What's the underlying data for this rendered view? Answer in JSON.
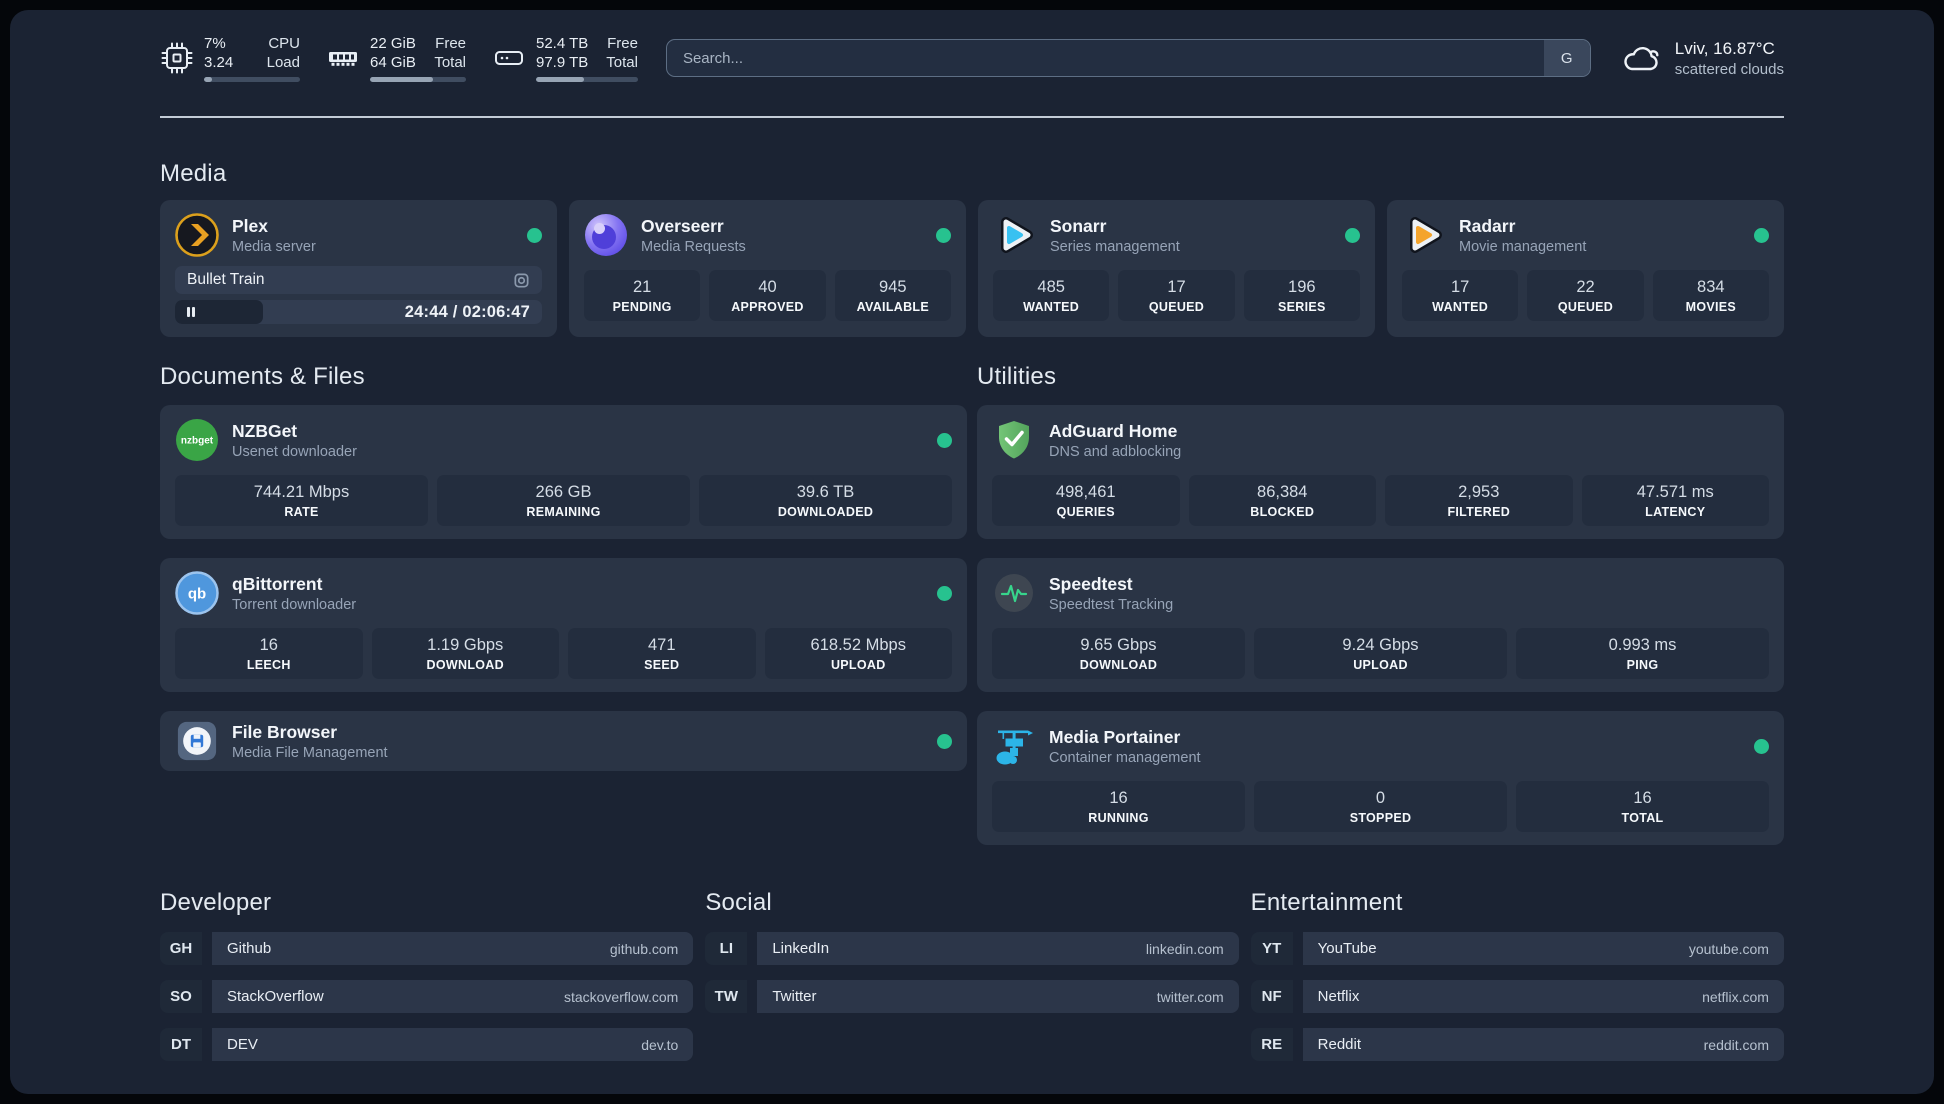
{
  "colors": {
    "background": "#1b2333",
    "card": "#2a3445",
    "stat_box": "#232d3e",
    "player_pill": "#323d51",
    "player_pause_bg": "#1d2635",
    "accent_green": "#27c28f",
    "divider": "#ccd5df",
    "bookmark_abbr_bg": "#1f2938",
    "bookmark_pill_bg": "#2c3649",
    "search_border": "#5d6e84",
    "search_bg": "#232e41",
    "search_engine_bg": "#3a475c",
    "progress_track": "#404d61",
    "progress_fill": "#97a4b4",
    "text_secondary": "#97a4b7"
  },
  "system": {
    "stats": [
      {
        "icon": "cpu",
        "v1": "7%",
        "v2": "3.24",
        "l1": "CPU",
        "l2": "Load",
        "progress": 8
      },
      {
        "icon": "memory",
        "v1": "22 GiB",
        "v2": "64 GiB",
        "l1": "Free",
        "l2": "Total",
        "progress": 66
      },
      {
        "icon": "disk",
        "v1": "52.4 TB",
        "v2": "97.9 TB",
        "l1": "Free",
        "l2": "Total",
        "progress": 47
      }
    ]
  },
  "search": {
    "placeholder": "Search...",
    "engine_button": "G"
  },
  "weather": {
    "location": "Lviv, 16.87°C",
    "condition": "scattered clouds"
  },
  "media": {
    "title": "Media",
    "plex": {
      "name": "Plex",
      "desc": "Media server",
      "player": {
        "title": "Bullet Train",
        "time": "24:44 / 02:06:47"
      }
    },
    "overseerr": {
      "name": "Overseerr",
      "desc": "Media Requests",
      "stats": [
        {
          "value": "21",
          "label": "PENDING"
        },
        {
          "value": "40",
          "label": "APPROVED"
        },
        {
          "value": "945",
          "label": "AVAILABLE"
        }
      ]
    },
    "sonarr": {
      "name": "Sonarr",
      "desc": "Series management",
      "stats": [
        {
          "value": "485",
          "label": "WANTED"
        },
        {
          "value": "17",
          "label": "QUEUED"
        },
        {
          "value": "196",
          "label": "SERIES"
        }
      ]
    },
    "radarr": {
      "name": "Radarr",
      "desc": "Movie management",
      "stats": [
        {
          "value": "17",
          "label": "WANTED"
        },
        {
          "value": "22",
          "label": "QUEUED"
        },
        {
          "value": "834",
          "label": "MOVIES"
        }
      ]
    }
  },
  "documents": {
    "title": "Documents & Files",
    "nzbget": {
      "name": "NZBGet",
      "desc": "Usenet downloader",
      "icon_text": "nzbget",
      "stats": [
        {
          "value": "744.21 Mbps",
          "label": "RATE"
        },
        {
          "value": "266 GB",
          "label": "REMAINING"
        },
        {
          "value": "39.6 TB",
          "label": "DOWNLOADED"
        }
      ]
    },
    "qbittorrent": {
      "name": "qBittorrent",
      "desc": "Torrent downloader",
      "icon_text": "qb",
      "stats": [
        {
          "value": "16",
          "label": "LEECH"
        },
        {
          "value": "1.19 Gbps",
          "label": "DOWNLOAD"
        },
        {
          "value": "471",
          "label": "SEED"
        },
        {
          "value": "618.52 Mbps",
          "label": "UPLOAD"
        }
      ]
    },
    "filebrowser": {
      "name": "File Browser",
      "desc": "Media File Management"
    }
  },
  "utilities": {
    "title": "Utilities",
    "adguard": {
      "name": "AdGuard Home",
      "desc": "DNS and adblocking",
      "stats": [
        {
          "value": "498,461",
          "label": "QUERIES"
        },
        {
          "value": "86,384",
          "label": "BLOCKED"
        },
        {
          "value": "2,953",
          "label": "FILTERED"
        },
        {
          "value": "47.571 ms",
          "label": "LATENCY"
        }
      ]
    },
    "speedtest": {
      "name": "Speedtest",
      "desc": "Speedtest Tracking",
      "stats": [
        {
          "value": "9.65 Gbps",
          "label": "DOWNLOAD"
        },
        {
          "value": "9.24 Gbps",
          "label": "UPLOAD"
        },
        {
          "value": "0.993 ms",
          "label": "PING"
        }
      ]
    },
    "portainer": {
      "name": "Media Portainer",
      "desc": "Container management",
      "stats": [
        {
          "value": "16",
          "label": "RUNNING"
        },
        {
          "value": "0",
          "label": "STOPPED"
        },
        {
          "value": "16",
          "label": "TOTAL"
        }
      ]
    }
  },
  "bookmarks": [
    {
      "title": "Developer",
      "items": [
        {
          "abbr": "GH",
          "name": "Github",
          "url": "github.com"
        },
        {
          "abbr": "SO",
          "name": "StackOverflow",
          "url": "stackoverflow.com"
        },
        {
          "abbr": "DT",
          "name": "DEV",
          "url": "dev.to"
        }
      ]
    },
    {
      "title": "Social",
      "items": [
        {
          "abbr": "LI",
          "name": "LinkedIn",
          "url": "linkedin.com"
        },
        {
          "abbr": "TW",
          "name": "Twitter",
          "url": "twitter.com"
        }
      ]
    },
    {
      "title": "Entertainment",
      "items": [
        {
          "abbr": "YT",
          "name": "YouTube",
          "url": "youtube.com"
        },
        {
          "abbr": "NF",
          "name": "Netflix",
          "url": "netflix.com"
        },
        {
          "abbr": "RE",
          "name": "Reddit",
          "url": "reddit.com"
        }
      ]
    }
  ]
}
